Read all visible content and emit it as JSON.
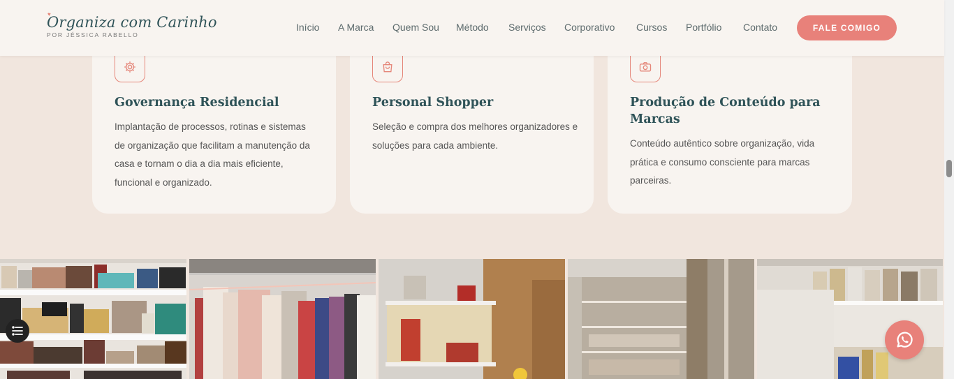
{
  "brand": {
    "name": "Organiza com Carinho",
    "subtitle": "POR JÉSSICA RABELLO"
  },
  "nav": {
    "items": [
      {
        "label": "Início"
      },
      {
        "label": "A Marca"
      },
      {
        "label": "Quem Sou"
      },
      {
        "label": "Método"
      },
      {
        "label": "Serviços"
      },
      {
        "label": "Corporativo"
      },
      {
        "label": "Cursos"
      },
      {
        "label": "Portfólio"
      },
      {
        "label": "Contato"
      }
    ],
    "cta_label": "FALE COMIGO"
  },
  "services": [
    {
      "icon": "gear-icon",
      "title": "Governança Residencial",
      "description": "Implantação de processos, rotinas e sistemas de organização que facilitam a manutenção da casa e tornam o dia a dia mais eficiente, funcional e organizado."
    },
    {
      "icon": "shopping-bag-icon",
      "title": "Personal Shopper",
      "description": "Seleção e compra dos melhores organizadores e soluções para cada ambiente."
    },
    {
      "icon": "camera-icon",
      "title": "Produção de Conteúdo para Marcas",
      "description": "Conteúdo autêntico sobre organização, vida prática e consumo consciente para marcas parceiras."
    }
  ],
  "colors": {
    "accent": "#e8817a",
    "brand_teal": "#2f5358",
    "page_bg": "#f1e6de",
    "card_bg": "#f8f4f0"
  }
}
